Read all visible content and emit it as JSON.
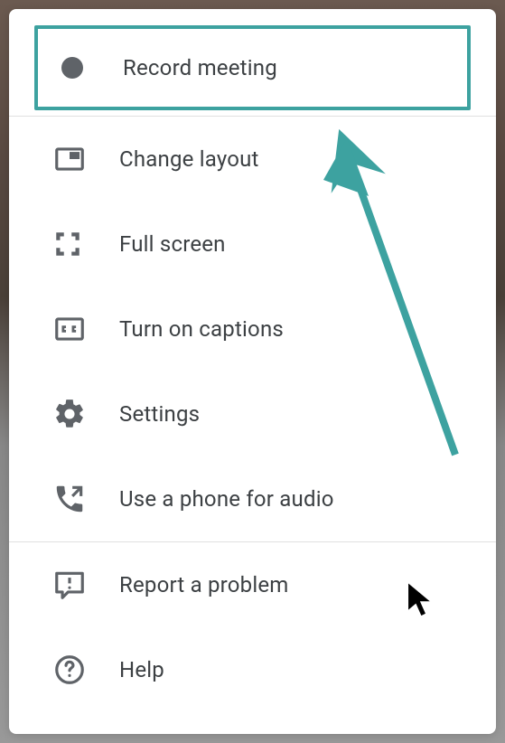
{
  "menu": {
    "sections": [
      {
        "items": [
          {
            "label": "Record meeting",
            "icon": "record",
            "name": "record-meeting",
            "highlighted": true
          }
        ]
      },
      {
        "items": [
          {
            "label": "Change layout",
            "icon": "layout",
            "name": "change-layout"
          },
          {
            "label": "Full screen",
            "icon": "fullscreen",
            "name": "full-screen"
          },
          {
            "label": "Turn on captions",
            "icon": "captions",
            "name": "turn-on-captions"
          },
          {
            "label": "Settings",
            "icon": "settings",
            "name": "settings"
          },
          {
            "label": "Use a phone for audio",
            "icon": "phone-audio",
            "name": "use-phone-audio"
          }
        ]
      },
      {
        "items": [
          {
            "label": "Report a problem",
            "icon": "feedback",
            "name": "report-problem"
          },
          {
            "label": "Help",
            "icon": "help",
            "name": "help"
          }
        ]
      }
    ]
  },
  "annotation": {
    "arrow_color": "#3da2a0",
    "highlight_color": "#3da2a0"
  }
}
